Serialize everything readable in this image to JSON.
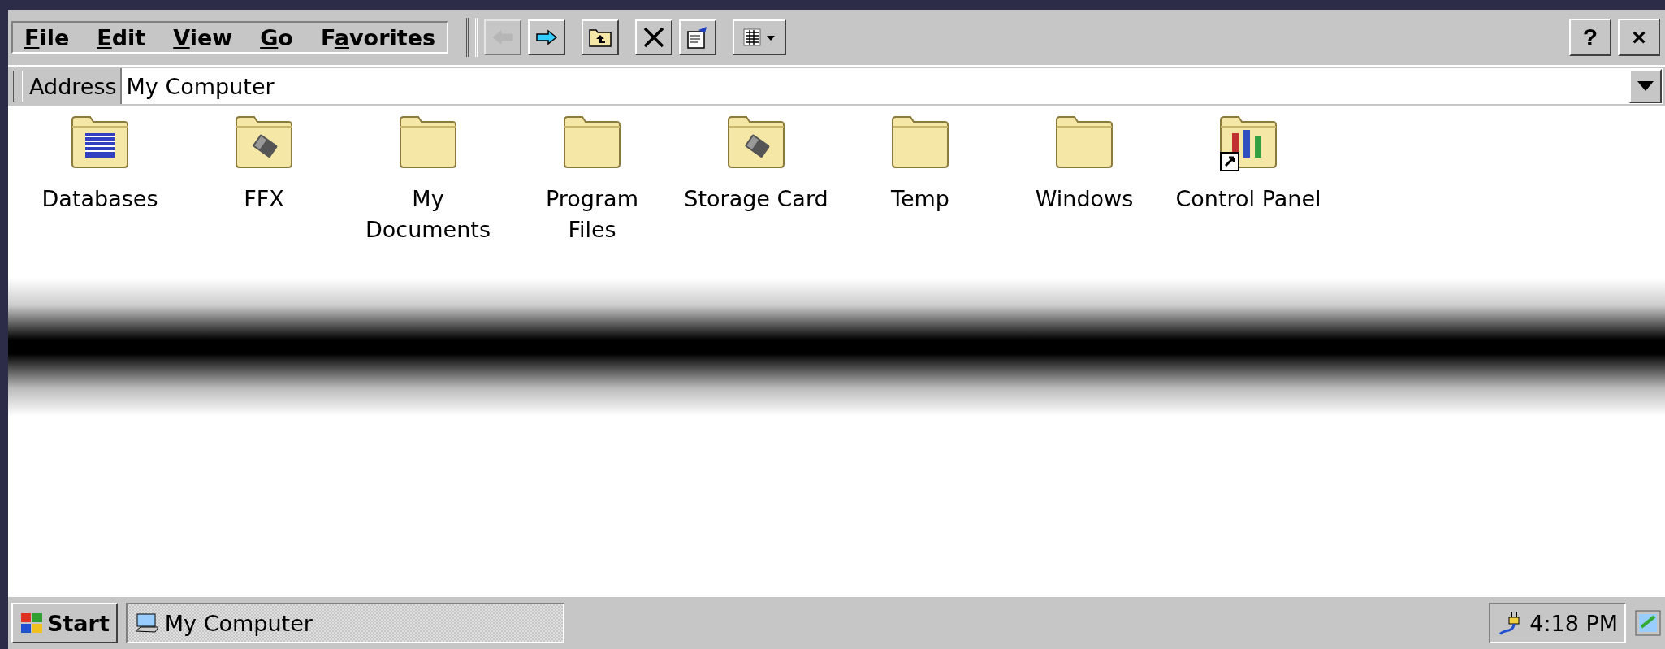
{
  "menu": [
    {
      "key": "F",
      "rest": "ile"
    },
    {
      "key": "E",
      "rest": "dit"
    },
    {
      "key": "V",
      "rest": "iew"
    },
    {
      "key": "G",
      "rest": "o"
    },
    {
      "lead": "F",
      "key": "a",
      "rest": "vorites"
    }
  ],
  "toolbar": [
    {
      "kind": "back",
      "disabled": true
    },
    {
      "kind": "forward",
      "disabled": false
    },
    {
      "kind": "up",
      "disabled": false
    },
    {
      "kind": "delete",
      "disabled": false
    },
    {
      "kind": "properties",
      "disabled": false
    },
    {
      "kind": "views",
      "disabled": false
    }
  ],
  "window_buttons": [
    "?",
    "×"
  ],
  "address": {
    "label": "Address",
    "value": "My Computer"
  },
  "items": [
    {
      "kind": "database",
      "label": "Databases"
    },
    {
      "kind": "storage",
      "label": "FFX"
    },
    {
      "kind": "folder",
      "label": "My Documents"
    },
    {
      "kind": "folder",
      "label": "Program Files"
    },
    {
      "kind": "storage",
      "label": "Storage Card"
    },
    {
      "kind": "folder",
      "label": "Temp"
    },
    {
      "kind": "folder",
      "label": "Windows"
    },
    {
      "kind": "control-panel",
      "label": "Control Panel"
    }
  ],
  "taskbar": {
    "start": "Start",
    "tasks": [
      {
        "label": "My Computer",
        "selected": true
      }
    ],
    "clock": "4:18 PM"
  }
}
